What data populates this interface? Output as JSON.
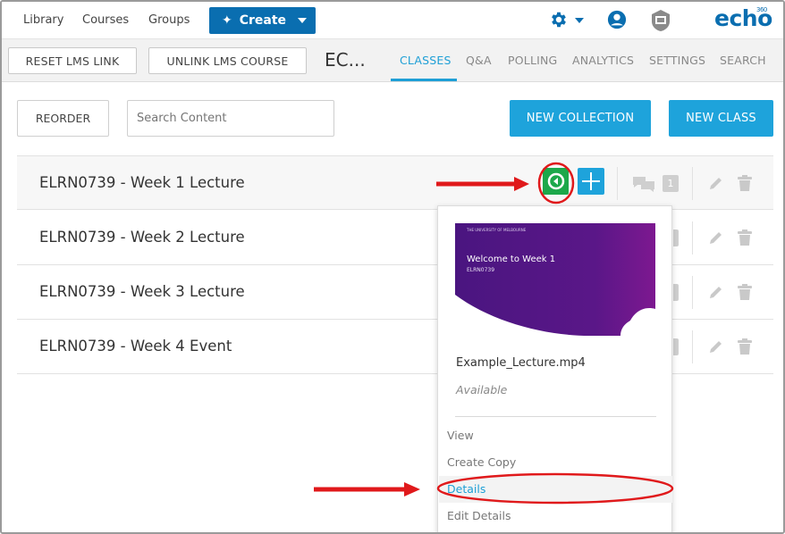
{
  "topnav": {
    "links": [
      "Library",
      "Courses",
      "Groups"
    ],
    "create_label": "Create",
    "logo": "echo",
    "logo_sup": "360"
  },
  "subbar": {
    "reset_label": "RESET LMS LINK",
    "unlink_label": "UNLINK LMS COURSE",
    "course_title": "EC...",
    "tabs": [
      "CLASSES",
      "Q&A",
      "POLLING",
      "ANALYTICS",
      "SETTINGS",
      "SEARCH"
    ],
    "active_tab": "CLASSES"
  },
  "toolbar": {
    "reorder_label": "REORDER",
    "search_placeholder": "Search Content",
    "new_collection_label": "NEW COLLECTION",
    "new_class_label": "NEW CLASS"
  },
  "rows": [
    {
      "title": "ELRN0739 - Week 1 Lecture",
      "qa_count": "1"
    },
    {
      "title": "ELRN0739 - Week 2 Lecture"
    },
    {
      "title": "ELRN0739 - Week 3 Lecture"
    },
    {
      "title": "ELRN0739 - Week 4 Event"
    }
  ],
  "popup": {
    "thumb_uni": "THE UNIVERSITY OF MELBOURNE",
    "thumb_title": "Welcome to Week 1",
    "thumb_sub": "ELRN0739",
    "filename": "Example_Lecture.mp4",
    "status": "Available",
    "menu": [
      "View",
      "Create Copy",
      "Details",
      "Edit Details"
    ]
  },
  "colors": {
    "brand": "#0a6eb0",
    "accent": "#1ea3db",
    "green": "#1ca84a",
    "annotation": "#e0191b"
  }
}
